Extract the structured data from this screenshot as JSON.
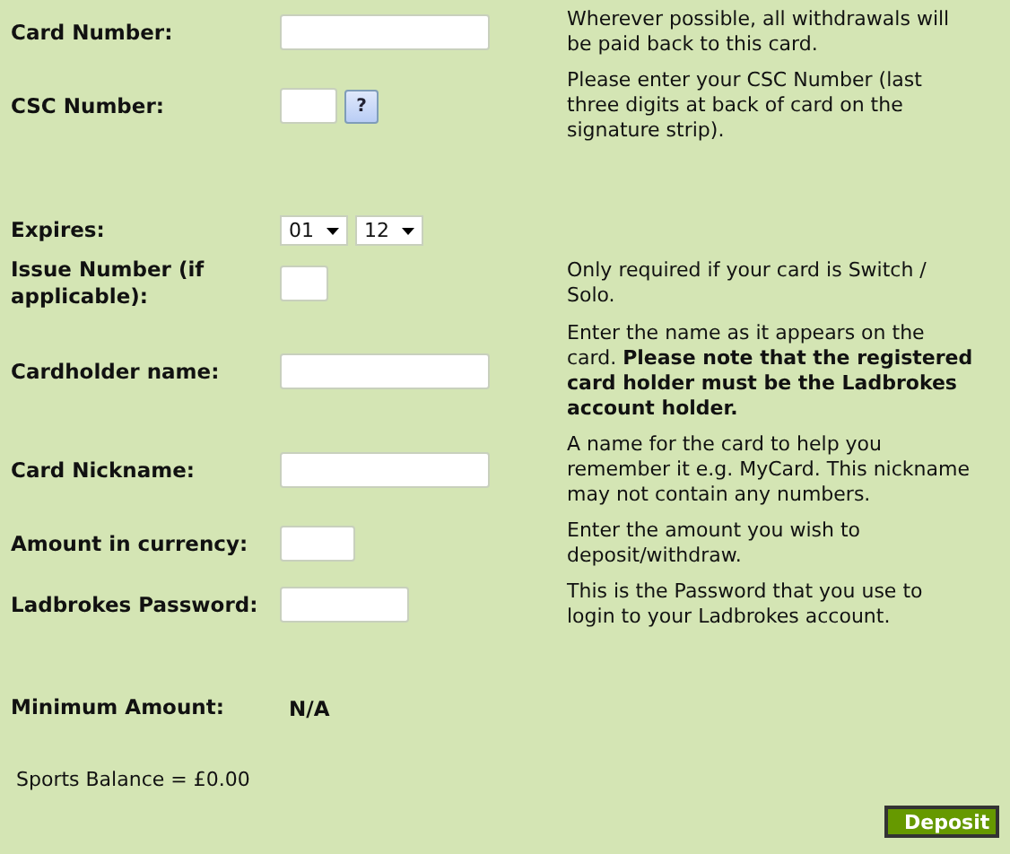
{
  "rows": [
    {
      "label": "Card Number:",
      "kind": "input",
      "help": "Wherever possible, all withdrawals will be paid back to this card."
    },
    {
      "label": "CSC Number:",
      "kind": "input",
      "help_button": "?",
      "help": "Please enter your CSC Number (last three digits at back of card on the signature strip)."
    },
    {
      "label": "Expires:",
      "kind": "selects",
      "selects": [
        {
          "value": "01"
        },
        {
          "value": "12"
        }
      ]
    },
    {
      "label": "Issue Number (if applicable):",
      "kind": "input",
      "help": "Only required if your card is Switch / Solo."
    },
    {
      "label": "Cardholder name:",
      "kind": "input",
      "help": "Enter the name as it appears on the card. **Please note that the registered card holder must be the Ladbrokes account holder.**"
    },
    {
      "label": "Card Nickname:",
      "kind": "input",
      "help": "A name for the card to help you remember it e.g. MyCard. This nickname may not contain any numbers."
    },
    {
      "label": "Amount in currency:",
      "kind": "input",
      "help": "Enter the amount you wish to deposit/withdraw."
    },
    {
      "label": "Ladbrokes Password:",
      "kind": "input",
      "help": "This is the Password that you use to login to your Ladbrokes account."
    },
    {
      "label": "Minimum Amount:",
      "kind": "value",
      "value": "N/A"
    }
  ],
  "balance": "Sports Balance = £0.00",
  "button": "Deposit"
}
